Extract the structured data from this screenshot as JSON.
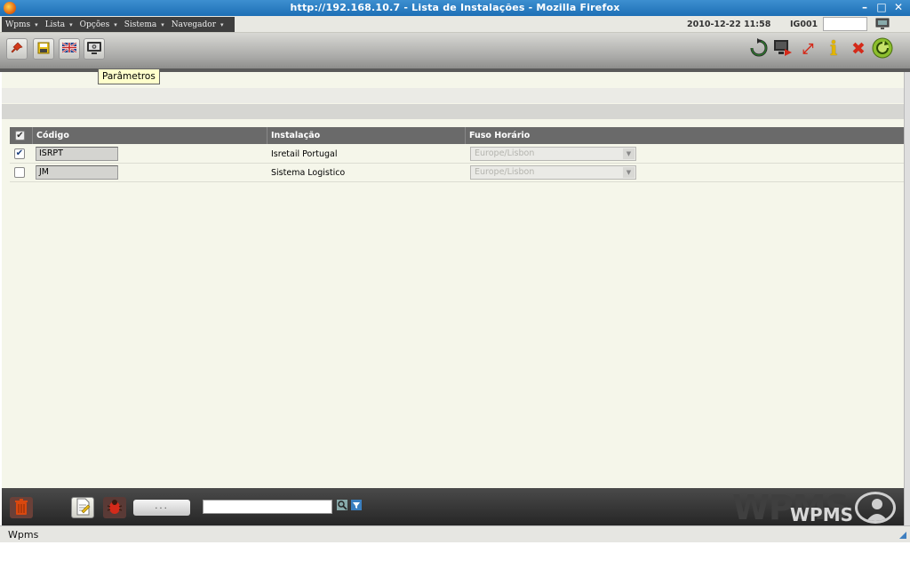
{
  "window": {
    "title": "http://192.168.10.7 - Lista de Instalações - Mozilla Firefox",
    "controls": [
      "–",
      "□",
      "✕"
    ]
  },
  "menu": {
    "items": [
      {
        "label": "Wpms"
      },
      {
        "label": "Lista"
      },
      {
        "label": "Opções"
      },
      {
        "label": "Sistema"
      },
      {
        "label": "Navegador"
      }
    ],
    "chevron": "▾",
    "datetime": "2010-12-22 11:58",
    "user": "IG001",
    "user_box_value": ""
  },
  "toolbar": {
    "left_icons": [
      "pin-icon",
      "save-icon",
      "flag-icon",
      "parameters-icon"
    ],
    "right_icons": [
      "refresh-icon",
      "export-icon",
      "expand-icon",
      "info-icon",
      "close-icon",
      "exit-icon"
    ],
    "info_glyph": "i",
    "close_glyph": "✖",
    "expand_glyph": "⤢",
    "tooltip": "Parâmetros"
  },
  "grid": {
    "columns": [
      {
        "label": "Código"
      },
      {
        "label": "Instalação"
      },
      {
        "label": "Fuso Horário"
      }
    ],
    "rows": [
      {
        "checked": true,
        "code": "ISRPT",
        "installation": "Isretail Portugal",
        "timezone": "Europe/Lisbon"
      },
      {
        "checked": false,
        "code": "JM",
        "installation": "Sistema Logistico",
        "timezone": "Europe/Lisbon"
      }
    ],
    "check_glyph": "✔",
    "select_arrow": "▼"
  },
  "footer": {
    "more_label": "...",
    "search_value": "",
    "watermark": "WPMS",
    "brand": "WPMS"
  },
  "status": {
    "text": "Wpms"
  },
  "colors": {
    "titlebar": "#1d6fb5",
    "header": "#6a6a6a",
    "content_bg": "#f5f6ea",
    "footer": "#262626",
    "close_red": "#d42a1a",
    "info_yellow": "#e2b400",
    "refresh_green": "#2c7a2c"
  }
}
